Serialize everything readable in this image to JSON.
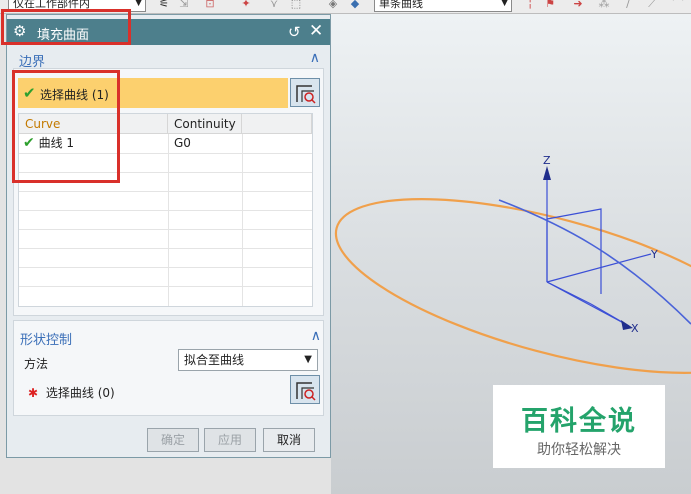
{
  "toolbar": {
    "filter_value": "仅在工作部件内",
    "curve_rule_value": "单条曲线",
    "icons": [
      "filter-icon",
      "select-icon",
      "snap-icon",
      "box-icon",
      "cube-icon"
    ]
  },
  "dialog": {
    "title": "填充曲面",
    "boundary": {
      "section_label": "边界",
      "select_label": "选择曲线 (1)",
      "table": {
        "columns": [
          "Curve",
          "Continuity"
        ],
        "rows": [
          {
            "curve": "曲线 1",
            "continuity": "G0",
            "checked": true
          }
        ]
      }
    },
    "shape_control": {
      "section_label": "形状控制",
      "method_label": "方法",
      "method_value": "拟合至曲线",
      "select_label": "选择曲线 (0)"
    },
    "buttons": {
      "ok": "确定",
      "apply": "应用",
      "cancel": "取消"
    }
  },
  "viewport": {
    "axes": {
      "z": "Z",
      "y": "Y",
      "x": "X"
    },
    "colors": {
      "ellipse": "#f0a04b",
      "axis": "#3b4fd6",
      "curve": "#4a63d8"
    }
  },
  "watermark": {
    "title": "百科全说",
    "subtitle": "助你轻松解决"
  },
  "colors": {
    "titlebar": "#4d7f8c",
    "selected_row": "#fcd06e",
    "section_label": "#3b6fb8",
    "highlight": "#d9302a",
    "watermark_green": "#24a36b"
  }
}
